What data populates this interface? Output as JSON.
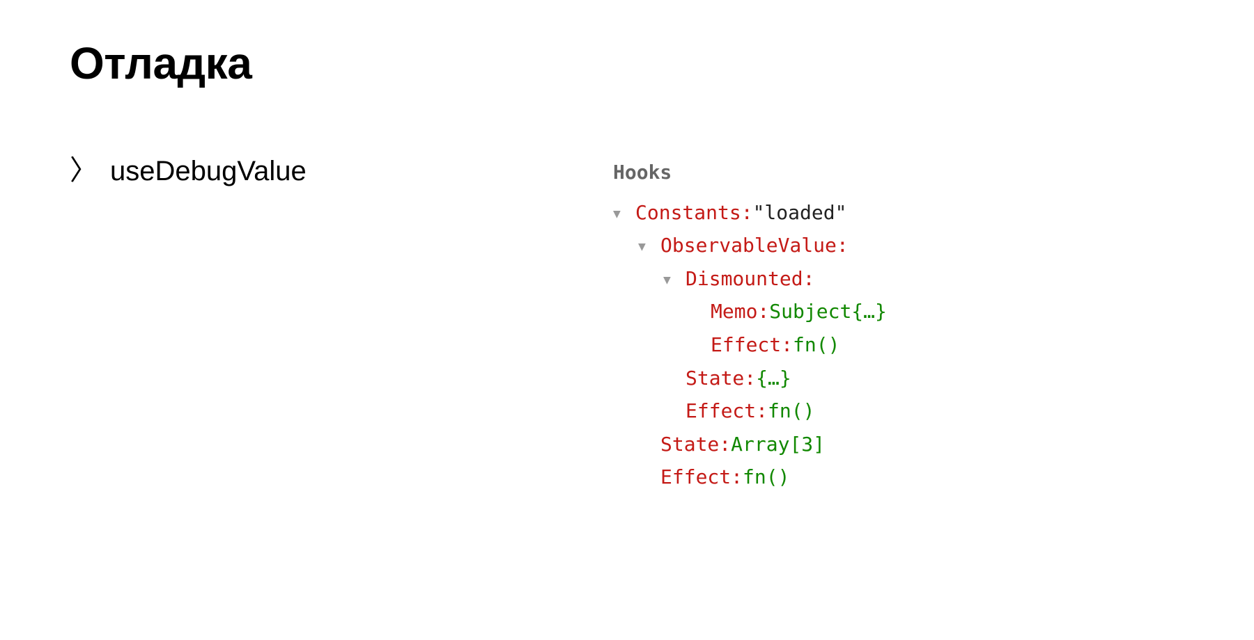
{
  "title": "Отладка",
  "bullet": {
    "chevron": "〉",
    "label": "useDebugValue"
  },
  "hooks_panel": {
    "heading": "Hooks",
    "tree": [
      {
        "indent": 0,
        "caret": true,
        "key": "Constants:",
        "value": "\"loaded\"",
        "value_class": "val-str"
      },
      {
        "indent": 1,
        "caret": true,
        "key": "ObservableValue:",
        "value": "",
        "value_class": "val-obj"
      },
      {
        "indent": 2,
        "caret": true,
        "key": "Dismounted:",
        "value": "",
        "value_class": "val-obj"
      },
      {
        "indent": 3,
        "caret": false,
        "key": "Memo:",
        "value": "Subject{…}",
        "value_class": "val-obj"
      },
      {
        "indent": 3,
        "caret": false,
        "key": "Effect:",
        "value": "fn()",
        "value_class": "val-obj"
      },
      {
        "indent": 2,
        "caret": false,
        "key": "State:",
        "value": "{…}",
        "value_class": "val-obj"
      },
      {
        "indent": 2,
        "caret": false,
        "key": "Effect:",
        "value": "fn()",
        "value_class": "val-obj"
      },
      {
        "indent": 1,
        "caret": false,
        "key": "State:",
        "value": "Array[3]",
        "value_class": "val-obj"
      },
      {
        "indent": 1,
        "caret": false,
        "key": "Effect:",
        "value": "fn()",
        "value_class": "val-obj"
      }
    ]
  }
}
